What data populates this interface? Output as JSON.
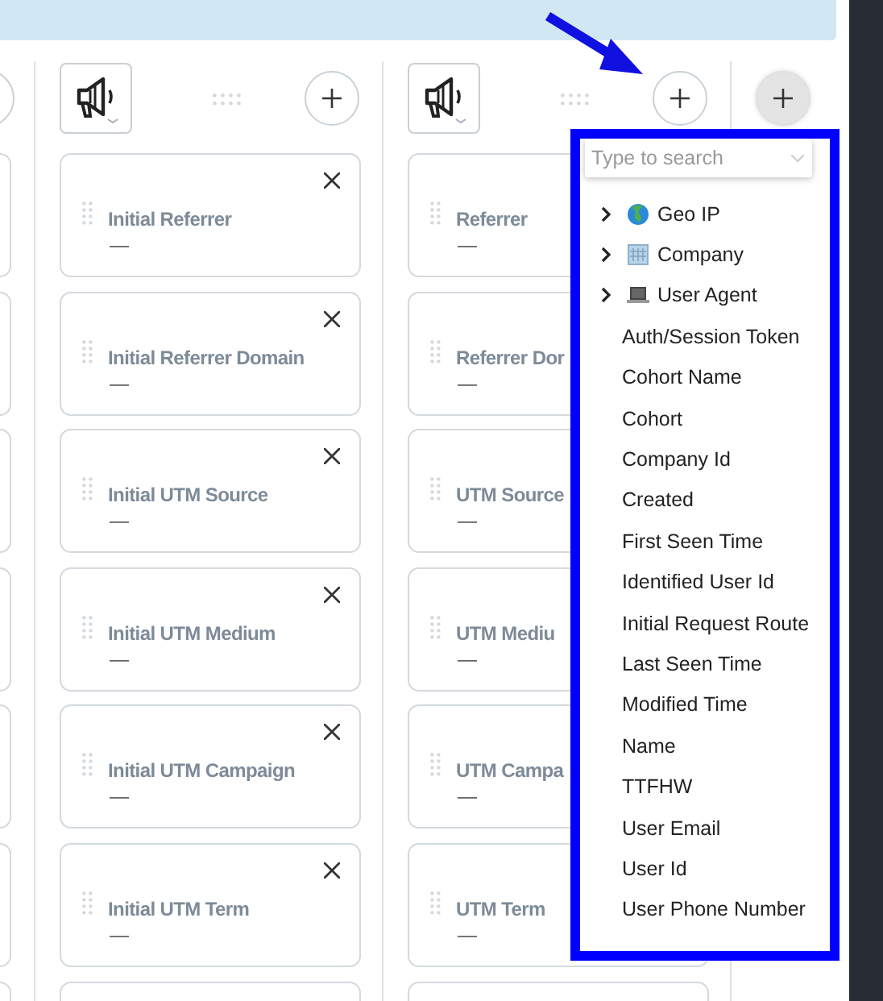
{
  "columns": [
    {
      "cards": [
        {
          "label": "Initial Referrer",
          "value": "—",
          "removable": true
        },
        {
          "label": "Initial Referrer Domain",
          "value": "—",
          "removable": true
        },
        {
          "label": "Initial UTM Source",
          "value": "—",
          "removable": true
        },
        {
          "label": "Initial UTM Medium",
          "value": "—",
          "removable": true
        },
        {
          "label": "Initial UTM Campaign",
          "value": "—",
          "removable": true
        },
        {
          "label": "Initial UTM Term",
          "value": "—",
          "removable": true
        }
      ]
    },
    {
      "cards": [
        {
          "label": "Referrer",
          "value": "—"
        },
        {
          "label": "Referrer Dor",
          "value": "—"
        },
        {
          "label": "UTM Source",
          "value": "—"
        },
        {
          "label": "UTM Mediu",
          "value": "—"
        },
        {
          "label": "UTM Campa",
          "value": "—"
        },
        {
          "label": "UTM Term",
          "value": "—"
        }
      ]
    }
  ],
  "dropdown": {
    "placeholder": "Type to search",
    "items": [
      {
        "kind": "globe",
        "label": "Geo IP"
      },
      {
        "kind": "building",
        "label": "Company"
      },
      {
        "kind": "laptop",
        "label": "User Agent"
      },
      {
        "kind": "field",
        "label": "Auth/Session Token"
      },
      {
        "kind": "field",
        "label": "Cohort Name"
      },
      {
        "kind": "field",
        "label": "Cohort"
      },
      {
        "kind": "field",
        "label": "Company Id"
      },
      {
        "kind": "field",
        "label": "Created"
      },
      {
        "kind": "field",
        "label": "First Seen Time"
      },
      {
        "kind": "field",
        "label": "Identified User Id"
      },
      {
        "kind": "field",
        "label": "Initial Request Route"
      },
      {
        "kind": "field",
        "label": "Last Seen Time"
      },
      {
        "kind": "field",
        "label": "Modified Time"
      },
      {
        "kind": "field",
        "label": "Name"
      },
      {
        "kind": "field",
        "label": "TTFHW"
      },
      {
        "kind": "field",
        "label": "User Email"
      },
      {
        "kind": "field",
        "label": "User Id"
      },
      {
        "kind": "field",
        "label": "User Phone Number"
      }
    ]
  }
}
